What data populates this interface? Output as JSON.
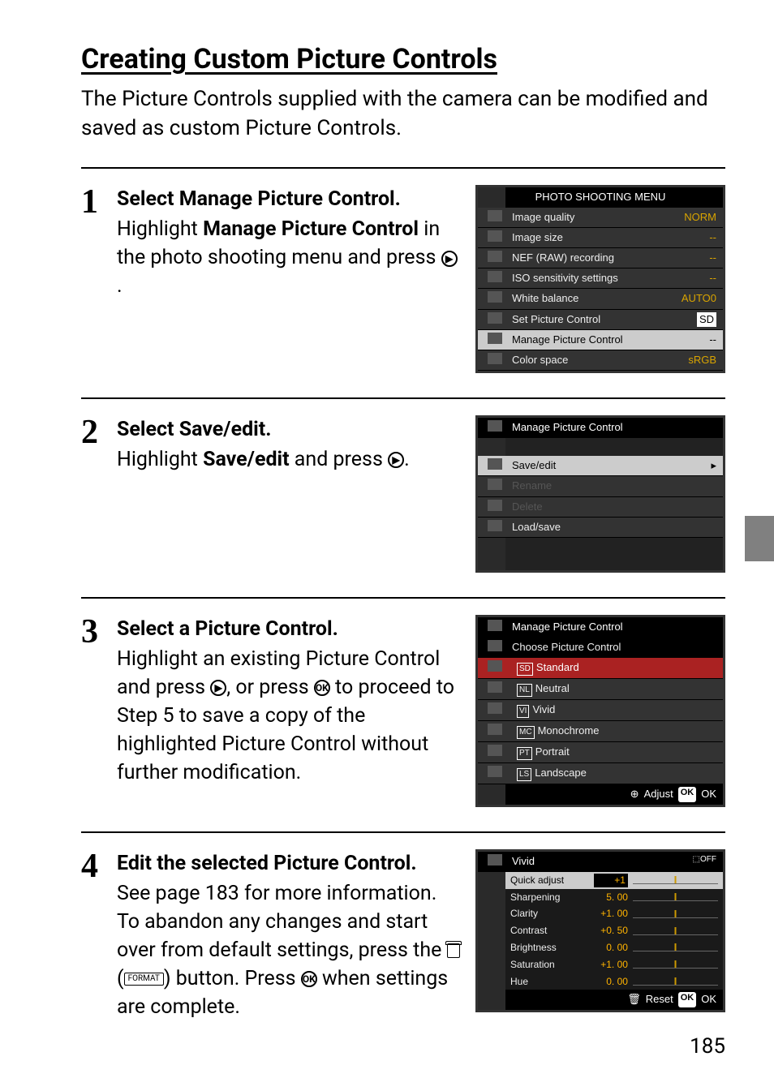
{
  "heading": "Creating Custom Picture Controls",
  "intro": "The Picture Controls supplied with the camera can be modified and saved as custom Picture Controls.",
  "steps": {
    "s1": {
      "num": "1",
      "title": "Select Manage Picture Control.",
      "body_pre": "Highlight ",
      "body_bold": "Manage Picture Control",
      "body_post": " in the photo shooting menu and press ",
      "body_end": "."
    },
    "s2": {
      "num": "2",
      "title": "Select Save/edit.",
      "body_pre": "Highlight ",
      "body_bold": "Save/edit",
      "body_post": " and press ",
      "body_end": "."
    },
    "s3": {
      "num": "3",
      "title": "Select a Picture Control.",
      "body": "Highlight an existing Picture Control and press ",
      "body_mid": ", or press ",
      "body_post": " to proceed to Step 5 to save a copy of the highlighted Picture Control without further modification."
    },
    "s4": {
      "num": "4",
      "title": "Edit the selected Picture Control.",
      "body": "See page 183 for more information. To abandon any changes and start over from default settings, press the ",
      "body_mid": " (",
      "body_mid2": ") button.  Press ",
      "body_post": " when settings are complete."
    }
  },
  "scr1": {
    "title": "PHOTO SHOOTING MENU",
    "r1": {
      "l": "Image quality",
      "v": "NORM"
    },
    "r2": {
      "l": "Image size",
      "v": "--"
    },
    "r3": {
      "l": "NEF (RAW) recording",
      "v": "--"
    },
    "r4": {
      "l": "ISO sensitivity settings",
      "v": "--"
    },
    "r5": {
      "l": "White balance",
      "v": "AUTO0"
    },
    "r6": {
      "l": "Set Picture Control",
      "v": "SD"
    },
    "r7": {
      "l": "Manage Picture Control",
      "v": "--"
    },
    "r8": {
      "l": "Color space",
      "v": "sRGB"
    }
  },
  "scr2": {
    "title": "Manage Picture Control",
    "r1": "Save/edit",
    "r2": "Rename",
    "r3": "Delete",
    "r4": "Load/save"
  },
  "scr3": {
    "title": "Manage Picture Control",
    "sub": "Choose Picture Control",
    "r1": {
      "i": "SD",
      "l": "Standard"
    },
    "r2": {
      "i": "NL",
      "l": "Neutral"
    },
    "r3": {
      "i": "VI",
      "l": "Vivid"
    },
    "r4": {
      "i": "MC",
      "l": "Monochrome"
    },
    "r5": {
      "i": "PT",
      "l": "Portrait"
    },
    "r6": {
      "i": "LS",
      "l": "Landscape"
    },
    "foot1": "Adjust",
    "foot2": "OK"
  },
  "scr4": {
    "title": "Vivid",
    "r1": {
      "l": "Quick adjust",
      "v": "+1"
    },
    "r2": {
      "l": "Sharpening",
      "v": "5. 00"
    },
    "r3": {
      "l": "Clarity",
      "v": "+1. 00"
    },
    "r4": {
      "l": "Contrast",
      "v": "+0. 50"
    },
    "r5": {
      "l": "Brightness",
      "v": "0. 00"
    },
    "r6": {
      "l": "Saturation",
      "v": "+1. 00"
    },
    "r7": {
      "l": "Hue",
      "v": "0. 00"
    },
    "foot1": "Reset",
    "foot2": "OK"
  },
  "page": "185",
  "icons": {
    "right": "▶",
    "ok": "OK",
    "format": "FORMAT"
  }
}
